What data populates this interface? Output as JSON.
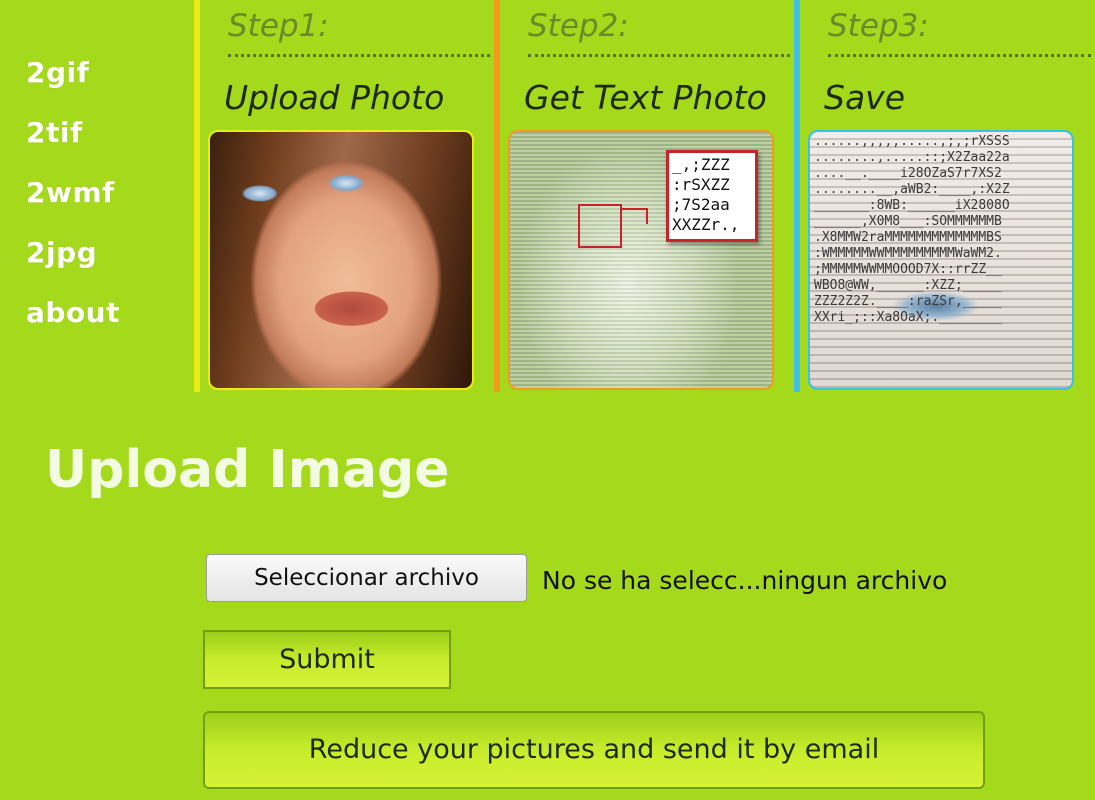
{
  "nav": {
    "items": [
      "2gif",
      "2tif",
      "2wmf",
      "2jpg",
      "about"
    ]
  },
  "steps": [
    {
      "number": "Step1:",
      "title": "Upload Photo",
      "accent": "#e9ec17"
    },
    {
      "number": "Step2:",
      "title": "Get Text Photo",
      "accent": "#f29a1c",
      "zoom_text": "_,;ZZZ\n:rSXZZ\n;7S2aa\nXXZZr.,"
    },
    {
      "number": "Step3:",
      "title": "Save",
      "accent": "#39c1e8",
      "ascii_text": "......,,,,,.....,;,;rXSSS\n........,.....::;X2Zaa22a\n....__.____i28OZaS7r7XS2\n........__,aWB2:____,:X2Z\n_______:8WB:______iX2808O\n______,X0M8___:SOMMMMMMB\n.X8MMW2raMMMMMMMMMMMMMBS\n:WMMMMMWWMMMMMMMMMWaWM2.\n;MMMMMWWMMOOOD7X::rrZZ__\nWBO8@WW,______:XZZ;_____\nZZZ2Z2Z.____:raZSr,_____\nXXri_;::Xa8OaX;.________"
    }
  ],
  "upload": {
    "title": "Upload Image",
    "file_button": "Seleccionar archivo",
    "file_status": "No se ha selecc...ningun archivo",
    "submit": "Submit",
    "email_button": "Reduce your pictures and send it by email"
  },
  "colors": {
    "background": "#a4d91c",
    "button_gradient_top": "#9ccf1a",
    "button_gradient_bottom": "#d6f236"
  }
}
